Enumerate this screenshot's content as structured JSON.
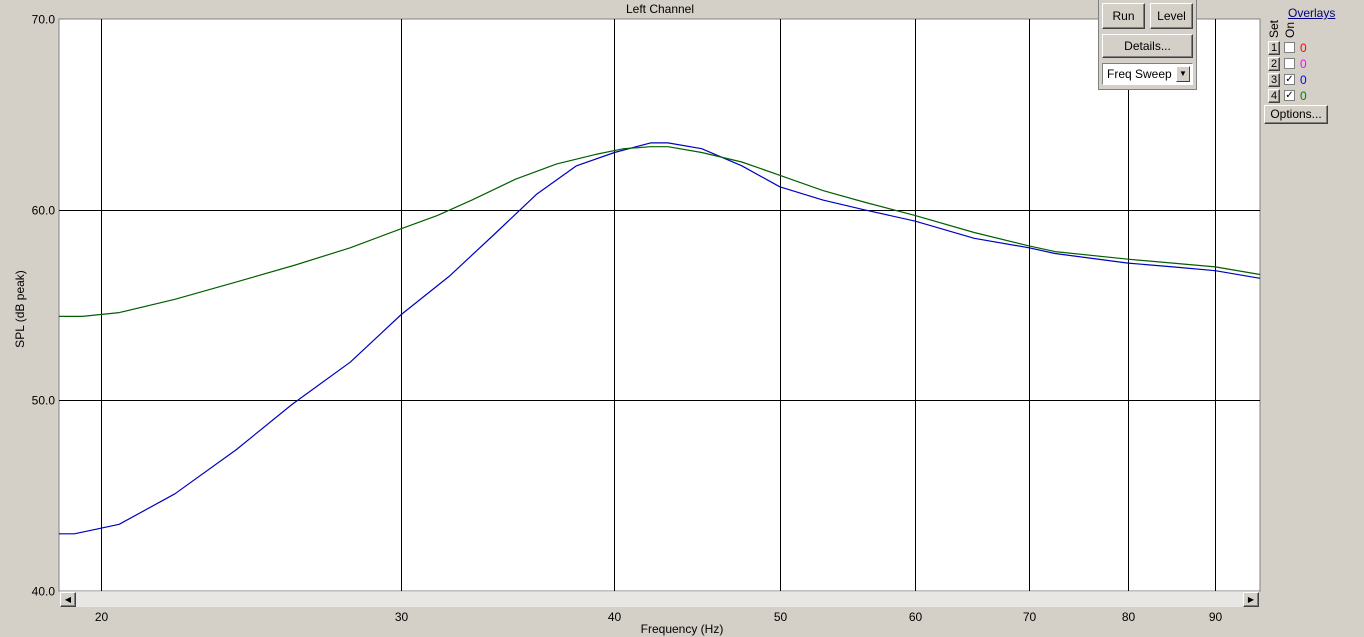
{
  "chart_data": {
    "type": "line",
    "title": "Left Channel",
    "xlabel": "Frequency (Hz)",
    "ylabel": "SPL (dB peak)",
    "xscale": "log",
    "xlim": [
      18.9,
      95.6
    ],
    "ylim": [
      40,
      70
    ],
    "xticks": [
      20,
      30,
      40,
      50,
      60,
      70,
      80,
      90
    ],
    "yticks": [
      40,
      50,
      60,
      70
    ],
    "ytick_labels": [
      "40.0",
      "50.0",
      "60.0",
      "70.0"
    ],
    "grid": true,
    "series": [
      {
        "color": "#0000c0",
        "x": [
          18.9,
          19.3,
          20.5,
          22.1,
          24.0,
          25.9,
          28.0,
          30.0,
          32.0,
          34.0,
          36.0,
          38.0,
          40.0,
          42.0,
          43.0,
          45.0,
          47.5,
          50.0,
          53.0,
          56.0,
          60.0,
          65.0,
          70.0,
          72.5,
          80.0,
          85.0,
          90.0,
          95.6
        ],
        "y": [
          43.0,
          43.0,
          43.5,
          45.1,
          47.4,
          49.8,
          52.0,
          54.5,
          56.5,
          58.7,
          60.8,
          62.3,
          63.0,
          63.5,
          63.5,
          63.2,
          62.3,
          61.2,
          60.5,
          60.0,
          59.4,
          58.5,
          58.0,
          57.7,
          57.2,
          57.0,
          56.8,
          56.4
        ]
      },
      {
        "color": "#006000",
        "x": [
          18.9,
          19.5,
          20.5,
          22.1,
          24.0,
          26.0,
          28.0,
          30.0,
          31.5,
          33.0,
          35.0,
          37.0,
          39.0,
          40.5,
          42.0,
          43.0,
          45.0,
          47.5,
          50.0,
          53.0,
          56.0,
          60.0,
          65.0,
          70.0,
          72.5,
          80.0,
          85.0,
          90.0,
          95.6
        ],
        "y": [
          54.4,
          54.4,
          54.6,
          55.3,
          56.2,
          57.1,
          58.0,
          59.0,
          59.7,
          60.5,
          61.6,
          62.4,
          62.9,
          63.2,
          63.3,
          63.3,
          63.0,
          62.5,
          61.8,
          61.0,
          60.4,
          59.7,
          58.8,
          58.1,
          57.8,
          57.4,
          57.2,
          57.0,
          56.6
        ]
      }
    ]
  },
  "controls": {
    "run_label": "Run",
    "level_label": "Level",
    "details_label": "Details...",
    "mode_value": "Freq Sweep"
  },
  "overlays": {
    "title": "Overlays",
    "set_header": "Set",
    "on_header": "On",
    "options_label": "Options...",
    "rows": [
      {
        "num": "1",
        "checked": false,
        "value": "0",
        "color": "#ff0000"
      },
      {
        "num": "2",
        "checked": false,
        "value": "0",
        "color": "#ff00ff"
      },
      {
        "num": "3",
        "checked": true,
        "value": "0",
        "color": "#0000ff"
      },
      {
        "num": "4",
        "checked": true,
        "value": "0",
        "color": "#008000"
      }
    ]
  }
}
